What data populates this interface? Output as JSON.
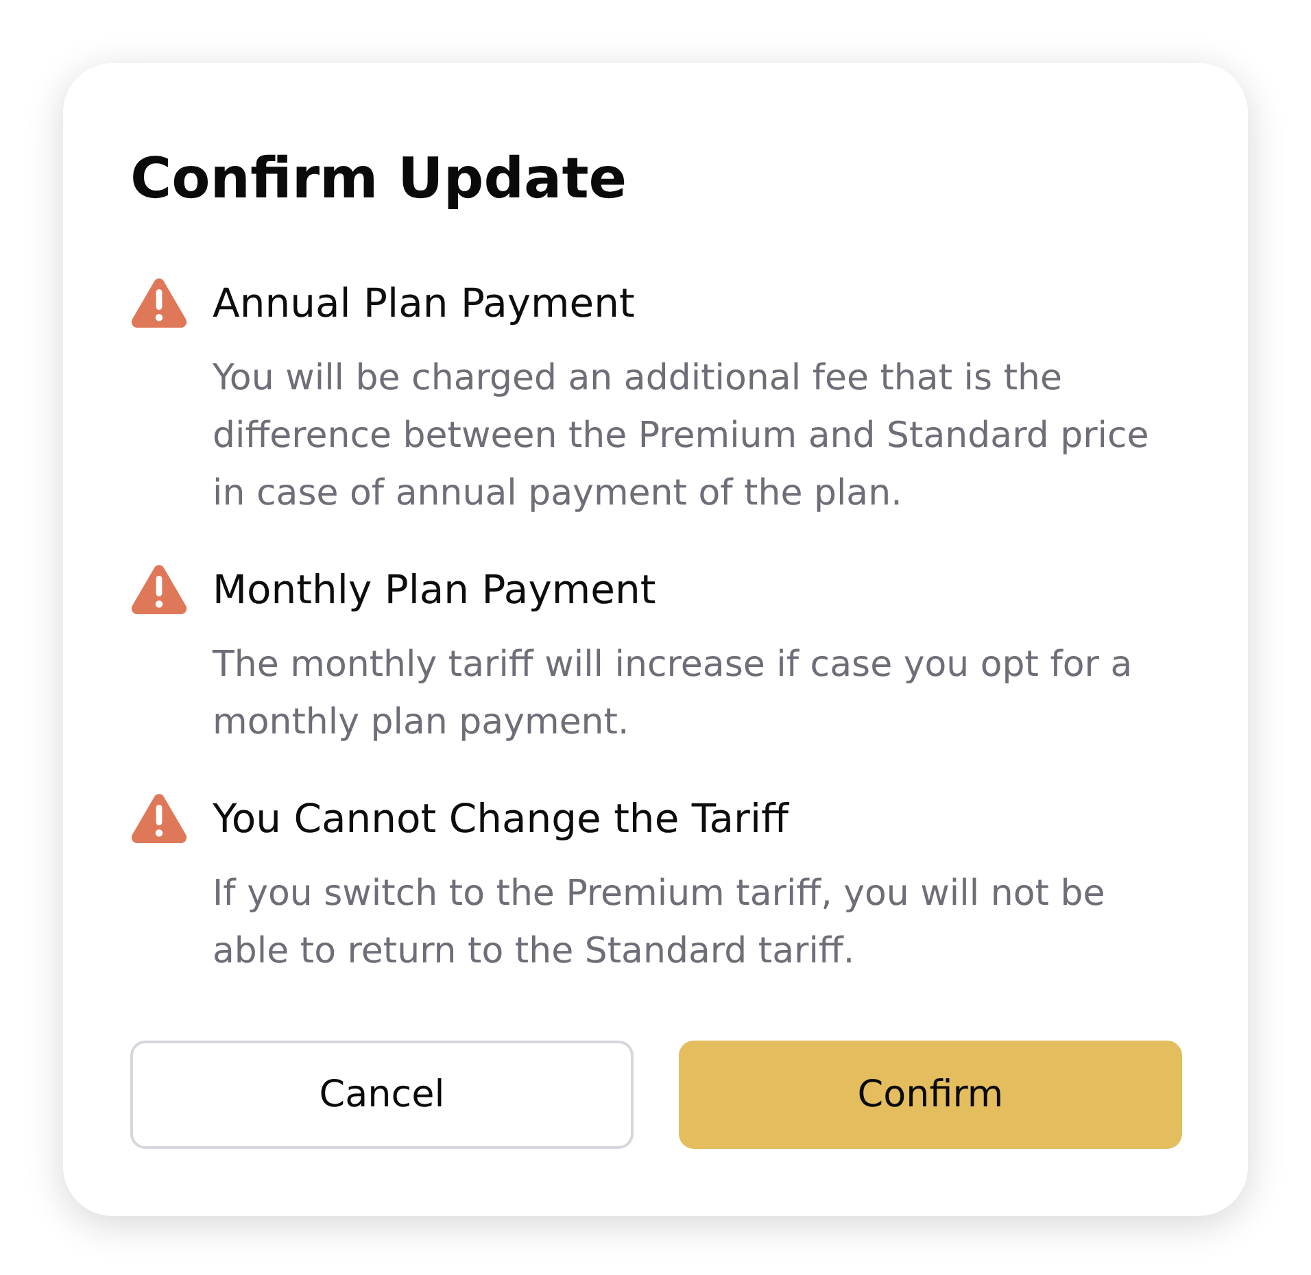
{
  "dialog": {
    "title": "Confirm Update",
    "warnings": [
      {
        "heading": "Annual Plan Payment",
        "text": "You will be charged an additional fee that is the difference between the Premium and Standard price in case of annual payment of the plan."
      },
      {
        "heading": "Monthly Plan Payment",
        "text": "The monthly tariff will increase if case you opt for a monthly plan payment."
      },
      {
        "heading": "You Cannot Change the Tariff",
        "text": "If you switch to the Premium tariff, you will not be able to return to the Standard tariff."
      }
    ],
    "buttons": [
      {
        "label": "Cancel",
        "kind": "secondary"
      },
      {
        "label": "Confirm",
        "kind": "primary"
      }
    ]
  }
}
